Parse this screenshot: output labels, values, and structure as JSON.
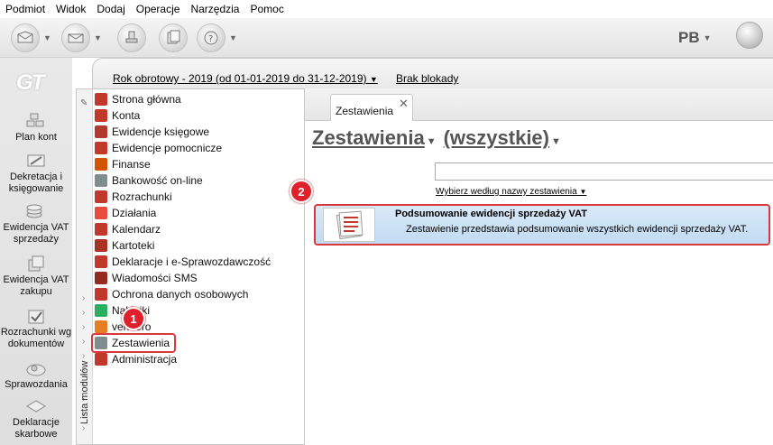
{
  "menu": {
    "items": [
      "Podmiot",
      "Widok",
      "Dodaj",
      "Operacje",
      "Narzędzia",
      "Pomoc"
    ]
  },
  "toolbar": {
    "buttons": [
      {
        "icon": "envelope-out-icon",
        "has_dropdown": true
      },
      {
        "icon": "envelope-in-icon",
        "has_dropdown": true
      },
      {
        "icon": "stamp-icon",
        "has_dropdown": false
      },
      {
        "icon": "documents-icon",
        "has_dropdown": false
      },
      {
        "icon": "help-icon",
        "has_dropdown": true
      }
    ],
    "user_initials": "PB"
  },
  "leftbar": {
    "logo": "GT",
    "items": [
      {
        "label": "Plan kont",
        "icon": "blocks-icon"
      },
      {
        "label": "Dekretacja i księgowanie",
        "icon": "pencil-icon"
      },
      {
        "label": "Ewidencja VAT sprzedaży",
        "icon": "coins-icon"
      },
      {
        "label": "Ewidencja VAT zakupu",
        "icon": "boxes-icon"
      },
      {
        "label": "Rozrachunki wg dokumentów",
        "icon": "check-icon"
      },
      {
        "label": "Sprawozdania",
        "icon": "report-icon"
      },
      {
        "label": "Deklaracje skarbowe",
        "icon": "declaration-icon"
      }
    ]
  },
  "infobar": {
    "year": "Rok obrotowy - 2019  (od 01-01-2019 do 31-12-2019)",
    "lock": "Brak blokady"
  },
  "modules": {
    "strip_label": "Lista modułów",
    "items": [
      {
        "label": "Strona główna",
        "color": "#c0392b"
      },
      {
        "label": "Konta",
        "color": "#c0392b"
      },
      {
        "label": "Ewidencje księgowe",
        "color": "#b03a2e"
      },
      {
        "label": "Ewidencje pomocnicze",
        "color": "#c0392b"
      },
      {
        "label": "Finanse",
        "color": "#d35400"
      },
      {
        "label": "Bankowość on-line",
        "color": "#7f8c8d"
      },
      {
        "label": "Rozrachunki",
        "color": "#c0392b"
      },
      {
        "label": "Działania",
        "color": "#e74c3c"
      },
      {
        "label": "Kalendarz",
        "color": "#c0392b"
      },
      {
        "label": "Kartoteki",
        "color": "#a93226"
      },
      {
        "label": "Deklaracje i e-Sprawozdawczość",
        "color": "#c0392b"
      },
      {
        "label": "Wiadomości SMS",
        "color": "#922b21"
      },
      {
        "label": "Ochrona danych osobowych",
        "color": "#c0392b"
      },
      {
        "label": "Naklejki",
        "color": "#27ae60"
      },
      {
        "label": "vendero",
        "color": "#e67e22"
      },
      {
        "label": "Zestawienia",
        "color": "#7f8c8d"
      },
      {
        "label": "Administracja",
        "color": "#c0392b"
      }
    ]
  },
  "tab": {
    "label": "Zestawienia",
    "close": "✕"
  },
  "content": {
    "heading": "Zestawienia",
    "filter": "(wszystkie)",
    "search_value": "",
    "search_hint": "Wybierz według nazwy zestawienia",
    "result": {
      "title": "Podsumowanie ewidencji sprzedaży VAT",
      "description": "Zestawienie przedstawia podsumowanie wszystkich ewidencji sprzedaży VAT."
    }
  },
  "callouts": {
    "first": "1",
    "second": "2"
  },
  "colors": {
    "highlight": "#d9383c",
    "badge": "#e0202a",
    "result_bg": "#c2dbf3"
  }
}
